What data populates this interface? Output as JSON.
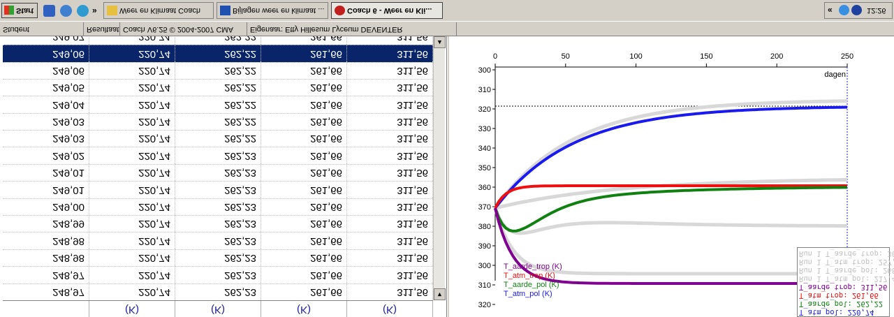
{
  "table": {
    "headers": [
      "",
      "(K)",
      "(K)",
      "(K)",
      "(K)"
    ],
    "rows": [
      [
        "248,97",
        "220,74",
        "262,23",
        "261,66",
        "311,56"
      ],
      [
        "248,97",
        "220,74",
        "262,23",
        "261,66",
        "311,56"
      ],
      [
        "248,98",
        "220,74",
        "262,23",
        "261,66",
        "311,56"
      ],
      [
        "248,98",
        "220,74",
        "262,23",
        "261,66",
        "311,56"
      ],
      [
        "248,99",
        "220,74",
        "262,23",
        "261,66",
        "311,56"
      ],
      [
        "249,00",
        "220,74",
        "262,23",
        "261,66",
        "311,56"
      ],
      [
        "249,01",
        "220,74",
        "262,23",
        "261,66",
        "311,56"
      ],
      [
        "249,01",
        "220,74",
        "262,23",
        "261,66",
        "311,56"
      ],
      [
        "249,02",
        "220,74",
        "262,23",
        "261,66",
        "311,56"
      ],
      [
        "249,03",
        "220,74",
        "262,22",
        "261,66",
        "311,56"
      ],
      [
        "249,03",
        "220,74",
        "262,22",
        "261,66",
        "311,56"
      ],
      [
        "249,04",
        "220,74",
        "262,22",
        "261,66",
        "311,56"
      ],
      [
        "249,05",
        "220,74",
        "262,22",
        "261,66",
        "311,56"
      ],
      [
        "249,06",
        "220,74",
        "262,22",
        "261,66",
        "311,56"
      ],
      [
        "249,06",
        "220,74",
        "262,22",
        "261,66",
        "311,56"
      ],
      [
        "249,07",
        "220,74",
        "262,22",
        "261,66",
        "311,56"
      ]
    ],
    "selected_row": 14
  },
  "graph": {
    "x_ticks": [
      "0",
      "50",
      "100",
      "150",
      "200",
      "250"
    ],
    "y_ticks": [
      "300",
      "310",
      "320",
      "330",
      "340",
      "350",
      "360",
      "370",
      "380",
      "390",
      "300",
      "310",
      "320"
    ],
    "x_unit": "dagen",
    "series_labels": [
      "T_atm_pol (K)",
      "T_aarde_pol (K)",
      "T_atm_trop (K)",
      "T_aarde_trop (K)"
    ],
    "colors": {
      "blue": "#1a1aee",
      "green": "#108010",
      "red": "#ee1010",
      "purple": "#800090",
      "gray": "#d8d8d8"
    },
    "legend": [
      {
        "text": "T_atm_pol: 220,74",
        "color": "#1a1aee"
      },
      {
        "text": "T_aarde_pol: 262,22",
        "color": "#108010"
      },
      {
        "text": "T_atm_trop: 261,66",
        "color": "#ee1010"
      },
      {
        "text": "T_aarde_trop: 311,56",
        "color": "#800090"
      },
      {
        "text": "Run 1 T_atm_pol: 217,46",
        "color": "#c0c0c0"
      },
      {
        "text": "Run 1 T_aarde_pol: 268,17",
        "color": "#c0c0c0"
      },
      {
        "text": "Run 1 T_atm_trop: 257,86",
        "color": "#c0c0c0"
      },
      {
        "text": "Run 1 T_aarde_trop: 306,56",
        "color": "#c0c0c0"
      }
    ]
  },
  "status_bar": {
    "segments": [
      "Student",
      "Resultaat",
      "Coach V6.25 © 2004-2007 CMA",
      "Eigenaar: Etty Hillesum Lyceum DEVENTER"
    ]
  },
  "taskbar": {
    "start_label": "Start",
    "chevron": "»",
    "tasks": [
      "Weer en Klimaat Coach",
      "Bijlagen weer en klimaat ...",
      "Coach 6 - Weer en Kli..."
    ],
    "tray_chevron": "«",
    "clock": "12:26"
  }
}
